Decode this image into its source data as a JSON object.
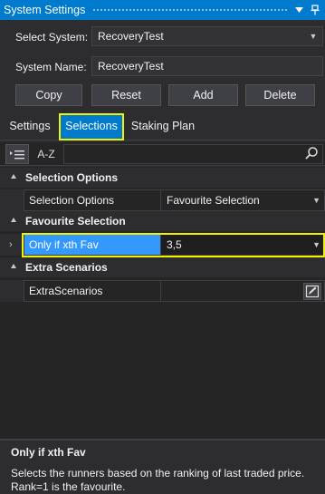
{
  "window": {
    "title": "System Settings",
    "icons": {
      "dropdown": "chevron-down-icon",
      "pin": "pin-icon"
    }
  },
  "form": {
    "select_system_label": "Select System:",
    "select_system_value": "RecoveryTest",
    "system_name_label": "System Name:",
    "system_name_value": "RecoveryTest"
  },
  "buttons": {
    "copy": "Copy",
    "reset": "Reset",
    "add": "Add",
    "delete": "Delete"
  },
  "tabs": [
    {
      "label": "Settings",
      "active": false
    },
    {
      "label": "Selections",
      "active": true
    },
    {
      "label": "Staking Plan",
      "active": false
    }
  ],
  "toolbar": {
    "categorized_icon": "categorized-list-icon",
    "alphabetical_label": "A-Z",
    "search_placeholder": "",
    "search_icon": "search-icon"
  },
  "property_grid": {
    "categories": [
      {
        "label": "Selection Options",
        "properties": [
          {
            "name": "Selection Options",
            "value": "Favourite Selection",
            "editor": "dropdown"
          }
        ]
      },
      {
        "label": "Favourite Selection",
        "properties": [
          {
            "name": "Only if xth Fav",
            "value": "3,5",
            "editor": "dropdown",
            "selected": true
          }
        ]
      },
      {
        "label": "Extra Scenarios",
        "properties": [
          {
            "name": "ExtraScenarios",
            "value": "",
            "editor": "edit-button"
          }
        ]
      }
    ]
  },
  "description": {
    "title": "Only if xth Fav",
    "line1": "Selects the runners based on the ranking of last traded price.",
    "line2": "Rank=1 is the favourite."
  },
  "colors": {
    "accent": "#007acc",
    "highlight": "#f2f200",
    "selection": "#3399ff",
    "background": "#2d2d30"
  }
}
